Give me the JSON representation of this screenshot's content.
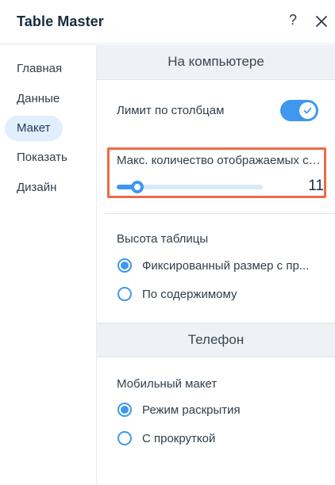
{
  "header": {
    "title": "Table Master",
    "help_label": "?",
    "close_icon": "close-icon"
  },
  "sidebar": {
    "items": [
      {
        "label": "Главная",
        "active": false
      },
      {
        "label": "Данные",
        "active": false
      },
      {
        "label": "Макет",
        "active": true
      },
      {
        "label": "Показать",
        "active": false
      },
      {
        "label": "Дизайн",
        "active": false
      }
    ]
  },
  "desktop": {
    "section_title": "На компьютере",
    "column_limit": {
      "label": "Лимит по столбцам",
      "enabled": true
    },
    "max_columns": {
      "label": "Макс. количество отображаемых сто...",
      "value": "11",
      "fill_fraction": 0.14
    },
    "table_height": {
      "label": "Высота таблицы",
      "options": [
        {
          "label": "Фиксированный размер с пр...",
          "checked": true
        },
        {
          "label": "По содержимому",
          "checked": false
        }
      ]
    }
  },
  "phone": {
    "section_title": "Телефон",
    "mobile_layout": {
      "label": "Мобильный макет",
      "options": [
        {
          "label": "Режим раскрытия",
          "checked": true
        },
        {
          "label": "С прокруткой",
          "checked": false
        }
      ]
    }
  },
  "colors": {
    "accent": "#3f97ee",
    "highlight": "#ee6a48",
    "nav_active_bg": "#e1eefc"
  }
}
